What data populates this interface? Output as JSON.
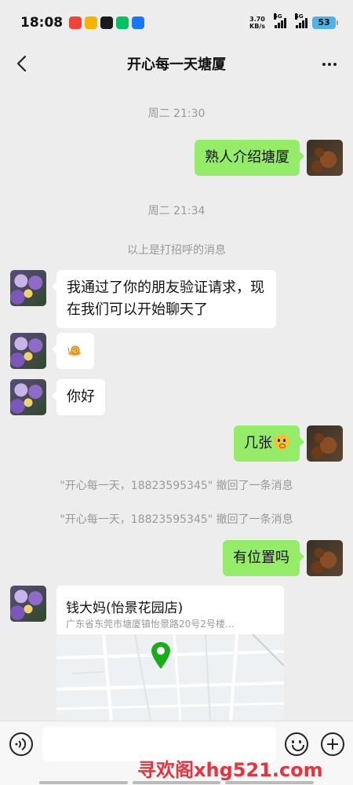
{
  "status_bar": {
    "time": "18:08",
    "net_speed_value": "3.70",
    "net_speed_unit": "KB/s",
    "signal_1": "5G",
    "signal_2": "5G",
    "battery": "53"
  },
  "header": {
    "title": "开心每一天塘厦"
  },
  "chat": {
    "timestamp_1": "周二 21:30",
    "timestamp_2": "周二 21:34",
    "greeting_notice": "以上是打招呼的消息",
    "recall_1": "\"开心每一天，18823595345\" 撤回了一条消息",
    "recall_2": "\"开心每一天，18823595345\" 撤回了一条消息",
    "messages": [
      {
        "side": "out",
        "text": "熟人介绍塘厦"
      },
      {
        "side": "in",
        "text": "我通过了你的朋友验证请求，现在我们可以开始聊天了"
      },
      {
        "side": "in",
        "text": ""
      },
      {
        "side": "in",
        "text": "你好"
      },
      {
        "side": "out",
        "text": "几张"
      },
      {
        "side": "out",
        "text": "有位置吗"
      }
    ],
    "location": {
      "name": "钱大妈(怡景花园店)",
      "address": "广东省东莞市塘厦镇怡景路20号2号楼…"
    }
  },
  "input_bar": {
    "watermark": "寻欢阁xhg521.com"
  },
  "colors": {
    "outgoing_bubble": "#95ec69",
    "incoming_bubble": "#ffffff",
    "background": "#ededed",
    "watermark": "#e8323c",
    "map_pin": "#1aad19"
  }
}
